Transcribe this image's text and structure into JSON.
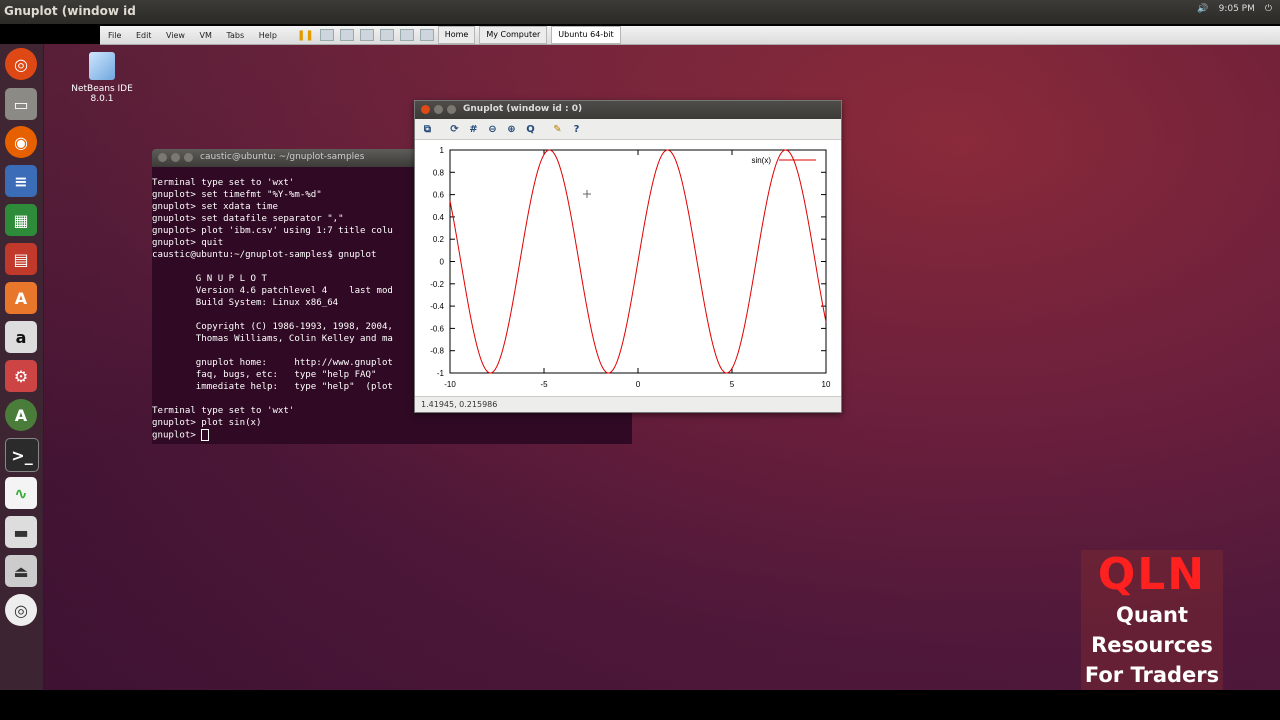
{
  "topbar": {
    "app_title": "Gnuplot (window id",
    "clock": "9:05 PM"
  },
  "vm": {
    "menus": [
      "File",
      "Edit",
      "View",
      "VM",
      "Tabs",
      "Help"
    ],
    "tabs": [
      {
        "label": "Home",
        "active": false
      },
      {
        "label": "My Computer",
        "active": false
      },
      {
        "label": "Ubuntu 64-bit",
        "active": true
      }
    ]
  },
  "desktop": {
    "icon_label": "NetBeans IDE 8.0.1"
  },
  "terminal": {
    "title": "caustic@ubuntu: ~/gnuplot-samples",
    "lines": [
      "Terminal type set to 'wxt'",
      "gnuplot> set timefmt \"%Y-%m-%d\"",
      "gnuplot> set xdata time",
      "gnuplot> set datafile separator \",\"",
      "gnuplot> plot 'ibm.csv' using 1:7 title colu",
      "gnuplot> quit",
      "caustic@ubuntu:~/gnuplot-samples$ gnuplot",
      "",
      "        G N U P L O T",
      "        Version 4.6 patchlevel 4    last mod",
      "        Build System: Linux x86_64",
      "",
      "        Copyright (C) 1986-1993, 1998, 2004,",
      "        Thomas Williams, Colin Kelley and ma",
      "",
      "        gnuplot home:     http://www.gnuplot",
      "        faq, bugs, etc:   type \"help FAQ\"",
      "        immediate help:   type \"help\"  (plot",
      "",
      "Terminal type set to 'wxt'",
      "gnuplot> plot sin(x)"
    ],
    "prompt": "gnuplot> "
  },
  "gnuplot": {
    "title": "Gnuplot (window id : 0)",
    "status": "1.41945, 0.215986"
  },
  "chart_data": {
    "type": "line",
    "function": "sin(x)",
    "series": [
      {
        "name": "sin(x)",
        "color": "#e00000"
      }
    ],
    "xlim": [
      -10,
      10
    ],
    "ylim": [
      -1,
      1
    ],
    "xticks": [
      "-10",
      "-5",
      "0",
      "5",
      "10"
    ],
    "yticks": [
      "1",
      "0.8",
      "0.6",
      "0.4",
      "0.2",
      "0",
      "-0.2",
      "-0.4",
      "-0.6",
      "-0.8",
      "-1"
    ],
    "legend": "top-right",
    "grid": false
  },
  "watermark": {
    "logo": "QLN",
    "line1": "Quant",
    "line2": "Resources",
    "line3": "For Traders"
  }
}
